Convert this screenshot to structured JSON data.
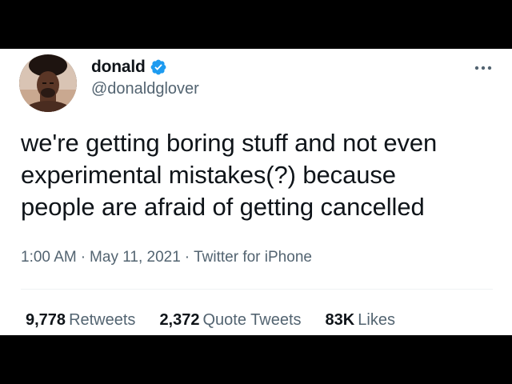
{
  "tweet": {
    "author": {
      "display_name": "donald",
      "handle": "@donaldglover",
      "verified": true,
      "avatar_icon": "profile-photo"
    },
    "more_icon": "more-horizontal-icon",
    "text": "we're getting boring stuff and not even\nexperimental mistakes(?) because\npeople are afraid of getting cancelled",
    "time": "1:00 AM",
    "separator": "·",
    "date": "May 11, 2021",
    "source": "Twitter for iPhone",
    "stats": {
      "retweets_count": "9,778",
      "retweets_label": "Retweets",
      "quotes_count": "2,372",
      "quotes_label": "Quote Tweets",
      "likes_count": "83K",
      "likes_label": "Likes"
    }
  },
  "colors": {
    "background": "#000000",
    "card": "#ffffff",
    "text": "#0f1419",
    "secondary_text": "#536471",
    "verified_blue": "#1d9bf0",
    "divider": "#eff3f4"
  }
}
